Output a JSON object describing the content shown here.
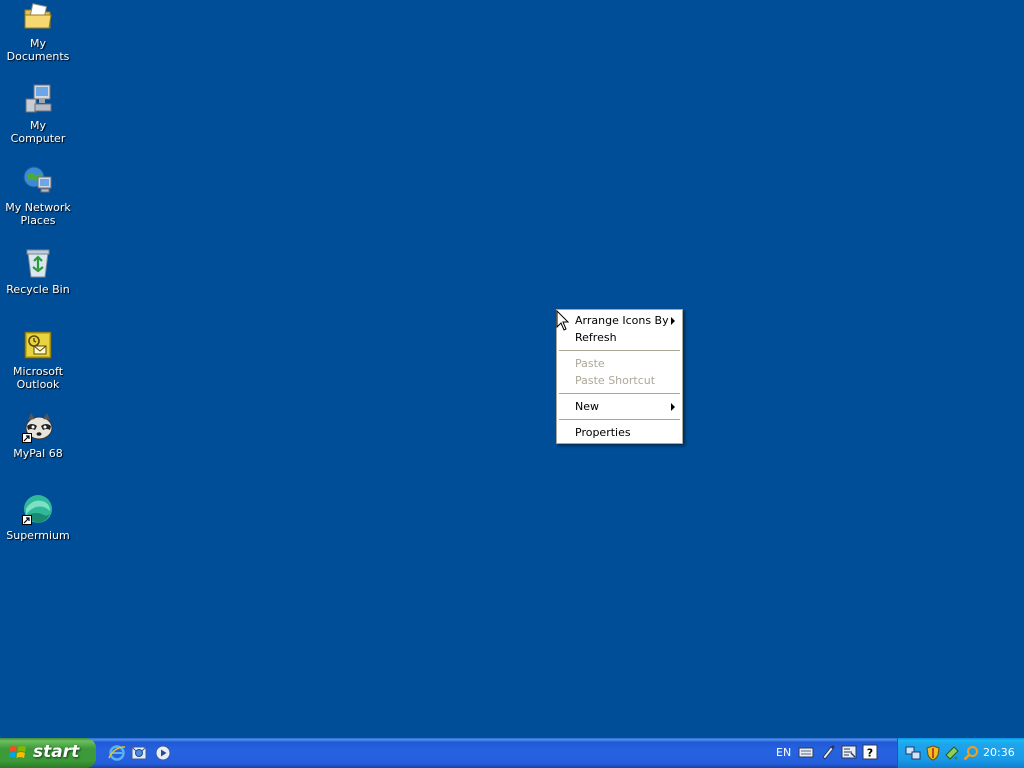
{
  "desktop": {
    "background_color": "#004e98",
    "icons": [
      {
        "label": "My Documents",
        "icon": "my-documents-folder-icon"
      },
      {
        "label": "My Computer",
        "icon": "computer-icon"
      },
      {
        "label": "My Network Places",
        "icon": "network-places-icon"
      },
      {
        "label": "Recycle Bin",
        "icon": "recycle-bin-icon"
      },
      {
        "label": "Microsoft Outlook",
        "icon": "outlook-icon"
      },
      {
        "label": "MyPal 68",
        "icon": "mypal-raccoon-icon"
      },
      {
        "label": "Supermium",
        "icon": "supermium-icon"
      }
    ]
  },
  "context_menu": {
    "items": [
      {
        "label": "Arrange Icons By",
        "has_submenu": true,
        "enabled": true
      },
      {
        "label": "Refresh",
        "has_submenu": false,
        "enabled": true
      },
      {
        "label": "Paste",
        "has_submenu": false,
        "enabled": false
      },
      {
        "label": "Paste Shortcut",
        "has_submenu": false,
        "enabled": false
      },
      {
        "label": "New",
        "has_submenu": true,
        "enabled": true
      },
      {
        "label": "Properties",
        "has_submenu": false,
        "enabled": true
      }
    ]
  },
  "taskbar": {
    "start_label": "start",
    "quick_launch": [
      {
        "icon": "internet-explorer-icon"
      },
      {
        "icon": "outlook-express-icon"
      },
      {
        "icon": "media-player-icon"
      }
    ],
    "language_label": "EN",
    "language_icons": [
      {
        "icon": "keyboard-icon"
      },
      {
        "icon": "pen-icon"
      },
      {
        "icon": "language-options-icon"
      },
      {
        "icon": "help-icon"
      }
    ],
    "tray_icons": [
      {
        "icon": "network-connection-icon"
      },
      {
        "icon": "security-shield-icon"
      },
      {
        "icon": "safely-remove-icon"
      },
      {
        "icon": "search-icon"
      }
    ],
    "clock": "20:36"
  },
  "colors": {
    "desktop": "#004e98",
    "taskbar": "#245edc",
    "start_button": "#3c9b38",
    "tray": "#1a9be8",
    "menu_disabled_text": "#aca899"
  }
}
